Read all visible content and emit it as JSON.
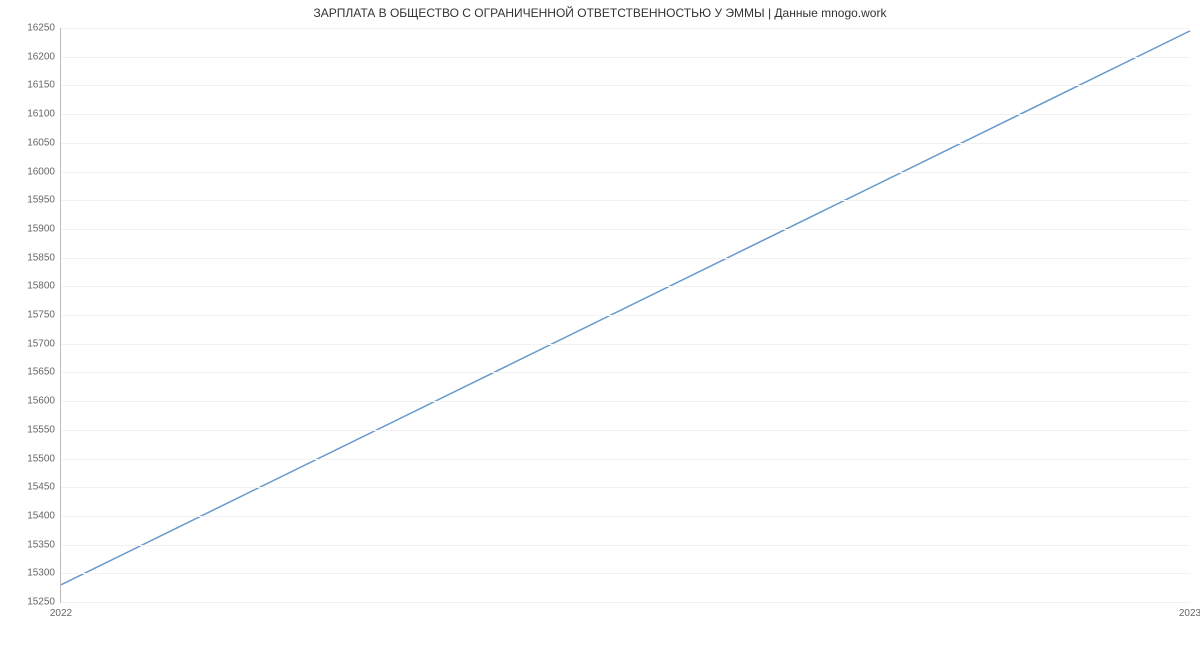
{
  "chart_data": {
    "type": "line",
    "title": "ЗАРПЛАТА В ОБЩЕСТВО С  ОГРАНИЧЕННОЙ ОТВЕТСТВЕННОСТЬЮ У ЭММЫ | Данные mnogo.work",
    "xlabel": "",
    "ylabel": "",
    "x": [
      "2022",
      "2023"
    ],
    "values": [
      15280,
      16245
    ],
    "ylim": [
      15250,
      16250
    ],
    "yticks": [
      15250,
      15300,
      15350,
      15400,
      15450,
      15500,
      15550,
      15600,
      15650,
      15700,
      15750,
      15800,
      15850,
      15900,
      15950,
      16000,
      16050,
      16100,
      16150,
      16200,
      16250
    ],
    "grid": true,
    "line_color": "#6699cc"
  }
}
